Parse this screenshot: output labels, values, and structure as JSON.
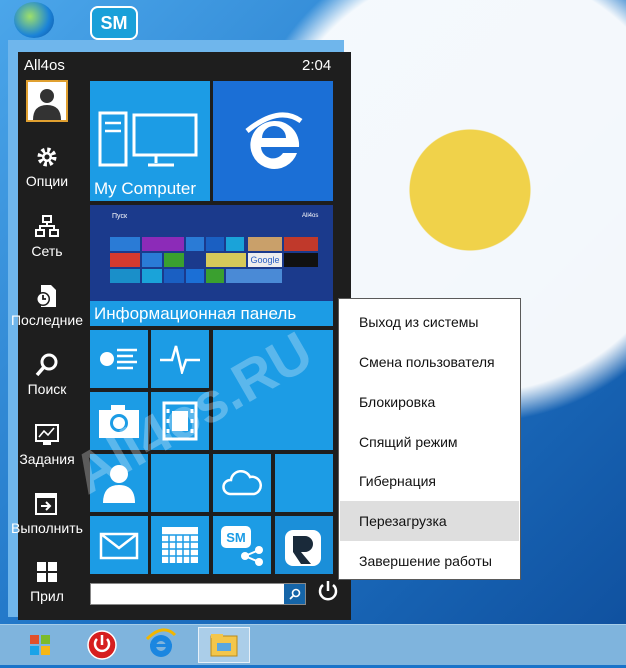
{
  "desktop": {
    "icons": [
      {
        "name": "network-globe-icon"
      },
      {
        "name": "sm-app-icon",
        "label": "SM"
      }
    ]
  },
  "startmenu": {
    "user_name": "All4os",
    "clock": "2:04",
    "sidebar": [
      {
        "icon": "gear-icon",
        "label": "Опции"
      },
      {
        "icon": "network-icon",
        "label": "Сеть"
      },
      {
        "icon": "recent-documents-icon",
        "label": "Последние"
      },
      {
        "icon": "search-icon",
        "label": "Поиск"
      },
      {
        "icon": "tasks-monitor-icon",
        "label": "Задания"
      },
      {
        "icon": "run-icon",
        "label": "Выполнить"
      },
      {
        "icon": "apps-grid-icon",
        "label": "Прил"
      }
    ],
    "tiles": {
      "my_computer": "My Computer",
      "info_panel": "Информационная панель",
      "info_preview_title": "Пуск",
      "info_preview_user": "All4os",
      "info_preview_google": "Google"
    },
    "search": {
      "placeholder": "",
      "value": ""
    }
  },
  "context_menu": {
    "items": [
      {
        "label": "Выход из системы",
        "highlighted": false
      },
      {
        "label": "Смена пользователя",
        "highlighted": false
      },
      {
        "label": "Блокировка",
        "highlighted": false
      },
      {
        "label": "Спящий режим",
        "highlighted": false
      },
      {
        "label": "Гибернация",
        "highlighted": false
      },
      {
        "label": "Перезагрузка",
        "highlighted": true
      },
      {
        "label": "Завершение работы",
        "highlighted": false
      }
    ]
  },
  "taskbar": {
    "buttons": [
      {
        "name": "windows-start-icon"
      },
      {
        "name": "power-app-icon"
      },
      {
        "name": "internet-explorer-icon"
      },
      {
        "name": "file-explorer-icon"
      }
    ]
  },
  "watermark": "All4os.RU",
  "colors": {
    "tile_blue": "#1c9ce5",
    "menu_dark": "#1e1e1e",
    "frame": "#6fb6ec",
    "ie_blue": "#1b6fd6"
  }
}
